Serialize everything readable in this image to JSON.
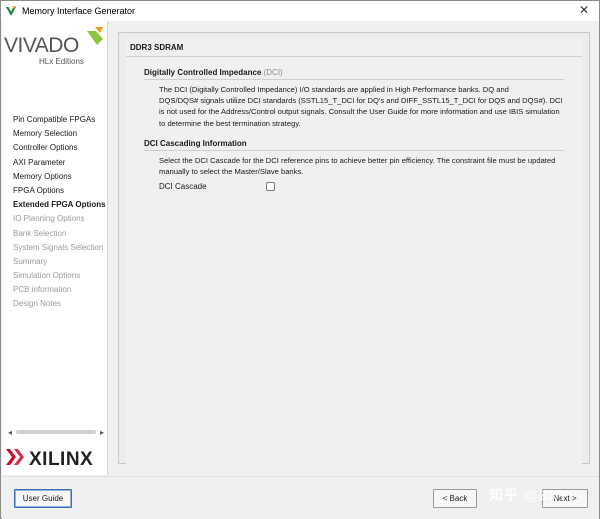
{
  "window": {
    "title": "Memory Interface Generator",
    "close_glyph": "✕"
  },
  "sidebar": {
    "brand": {
      "name": "VIVADO",
      "edition": "HLx Editions"
    },
    "vendor": "XILINX",
    "items": [
      {
        "label": "Pin Compatible FPGAs",
        "state": "done"
      },
      {
        "label": "Memory Selection",
        "state": "done"
      },
      {
        "label": "Controller Options",
        "state": "done"
      },
      {
        "label": "AXI Parameter",
        "state": "done"
      },
      {
        "label": "Memory Options",
        "state": "done"
      },
      {
        "label": "FPGA Options",
        "state": "done"
      },
      {
        "label": "Extended FPGA Options",
        "state": "current"
      },
      {
        "label": "IO Planning Options",
        "state": "todo"
      },
      {
        "label": "Bank Selection",
        "state": "todo"
      },
      {
        "label": "System Signals Selection",
        "state": "todo"
      },
      {
        "label": "Summary",
        "state": "todo"
      },
      {
        "label": "Simulation Options",
        "state": "todo"
      },
      {
        "label": "PCB information",
        "state": "todo"
      },
      {
        "label": "Design Notes",
        "state": "todo"
      }
    ],
    "scroll_left": "◂",
    "scroll_right": "▸"
  },
  "main": {
    "header": "DDR3 SDRAM",
    "dci": {
      "title": "Digitally Controlled Impedance",
      "title_suffix": "(DCI)",
      "lines": [
        "The DCI (Digitally Controlled Impedance) I/O standards are applied in High Performance banks. DQ and",
        "DQS/DQS# signals utilize DCI standards (SSTL15_T_DCI for DQ's and DIFF_SSTL15_T_DCI for DQS and DQS#). DCI",
        "is not used for the Address/Control output signals. Consult the User Guide for more information and use IBIS simulation",
        "to determine the best termination strategy."
      ]
    },
    "cascading": {
      "title": "DCI Cascading Information",
      "lines": [
        "Select the DCI Cascade for the DCI reference pins to achieve better pin efficiency. The constraint file must be updated",
        "manually to select the Master/Slave banks."
      ],
      "checkbox_label": "DCI Cascade",
      "checked": false
    }
  },
  "footer": {
    "user_guide": "User Guide",
    "back": "< Back",
    "next": "Next >",
    "watermark": "知乎 @ZXY"
  }
}
